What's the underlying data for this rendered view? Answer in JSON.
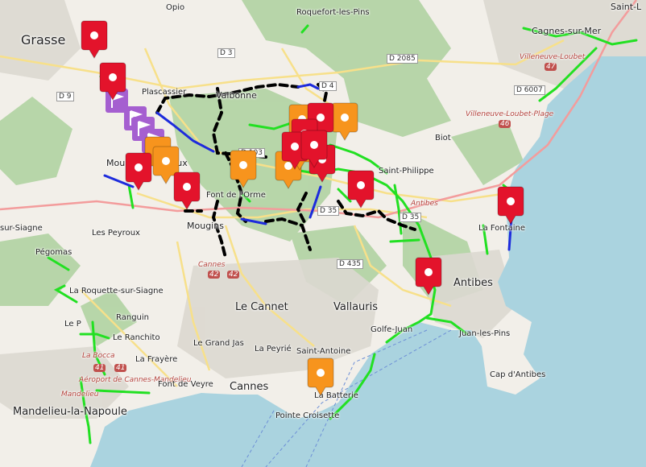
{
  "map": {
    "colors": {
      "sea": "#aad3df",
      "land": "#f2efe9",
      "forest": "#add19e",
      "urban": "#dddddd",
      "route_green": "#22e022",
      "route_black": "#000000",
      "route_blue": "#1d2bdc",
      "marker_red": "#e3132b",
      "marker_orange": "#f7941d",
      "marker_purple": "#a55fd0"
    },
    "towns": [
      {
        "name": "Grasse",
        "cls": "city"
      },
      {
        "name": "Opio",
        "cls": "small"
      },
      {
        "name": "Roquefort-les-Pins",
        "cls": "small"
      },
      {
        "name": "Cagnes-sur-Mer",
        "cls": "town"
      },
      {
        "name": "Saint-L",
        "cls": "town"
      },
      {
        "name": "Villeneuve-Loubet",
        "cls": "red"
      },
      {
        "name": "Villeneuve-Loubet-Plage",
        "cls": "red"
      },
      {
        "name": "Plascassier",
        "cls": "small"
      },
      {
        "name": "Valbonne",
        "cls": "town"
      },
      {
        "name": "Biot",
        "cls": "small"
      },
      {
        "name": "Saint-Philippe",
        "cls": "small"
      },
      {
        "name": "Antibes",
        "cls": "red"
      },
      {
        "name": "La Fontaine",
        "cls": "small"
      },
      {
        "name": "Mouans",
        "cls": "town"
      },
      {
        "name": "Sartoux",
        "cls": "town"
      },
      {
        "name": "Font de l'Orme",
        "cls": "small"
      },
      {
        "name": "Mougins",
        "cls": "town"
      },
      {
        "name": "sur-Siagne",
        "cls": "small"
      },
      {
        "name": "Les Peyroux",
        "cls": "small"
      },
      {
        "name": "Pégomas",
        "cls": "small"
      },
      {
        "name": "Antibes",
        "cls": "city"
      },
      {
        "name": "La Roquette-sur-Siagne",
        "cls": "small"
      },
      {
        "name": "Cannes",
        "cls": "red"
      },
      {
        "name": "Le Cannet",
        "cls": "city"
      },
      {
        "name": "Vallauris",
        "cls": "city"
      },
      {
        "name": "Ranguin",
        "cls": "small"
      },
      {
        "name": "Le P",
        "cls": "small"
      },
      {
        "name": "Le Ranchito",
        "cls": "small"
      },
      {
        "name": "Golfe-Juan",
        "cls": "small"
      },
      {
        "name": "Juan-les-Pins",
        "cls": "small"
      },
      {
        "name": "Le Grand Jas",
        "cls": "small"
      },
      {
        "name": "La Peyrié",
        "cls": "small"
      },
      {
        "name": "Saint-Antoine",
        "cls": "small"
      },
      {
        "name": "La Bocca",
        "cls": "red"
      },
      {
        "name": "La Frayère",
        "cls": "small"
      },
      {
        "name": "Aéroport de Cannes-Mandelieu",
        "cls": "red"
      },
      {
        "name": "Font de Veyre",
        "cls": "small"
      },
      {
        "name": "Cannes",
        "cls": "city"
      },
      {
        "name": "Cap d'Antibes",
        "cls": "small"
      },
      {
        "name": "Mandelieu",
        "cls": "red"
      },
      {
        "name": "Mandelieu-la-Napoule",
        "cls": "city"
      },
      {
        "name": "La Batterie",
        "cls": "small"
      },
      {
        "name": "Pointe Croisette",
        "cls": "small"
      }
    ],
    "roads": [
      "D 9",
      "D 3",
      "D 2085",
      "D 4",
      "D 6007",
      "D 103",
      "D 35",
      "D 35",
      "D 435"
    ],
    "shields": [
      "47",
      "46",
      "42",
      "42",
      "41",
      "41"
    ]
  }
}
